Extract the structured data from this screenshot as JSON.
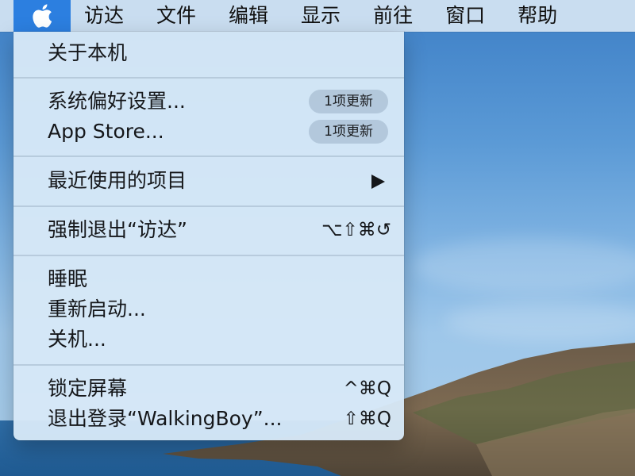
{
  "menubar": {
    "apple_icon": "apple-icon",
    "items": [
      {
        "label": "访达"
      },
      {
        "label": "文件"
      },
      {
        "label": "编辑"
      },
      {
        "label": "显示"
      },
      {
        "label": "前往"
      },
      {
        "label": "窗口"
      },
      {
        "label": "帮助"
      }
    ]
  },
  "apple_menu": {
    "about": "关于本机",
    "system_prefs": {
      "label": "系统偏好设置...",
      "badge": "1项更新"
    },
    "app_store": {
      "label": "App Store...",
      "badge": "1项更新"
    },
    "recent_items": {
      "label": "最近使用的项目",
      "icon": "submenu-arrow-icon"
    },
    "force_quit": {
      "label": "强制退出“访达”",
      "shortcut": "⌥⇧⌘↺"
    },
    "sleep": "睡眠",
    "restart": "重新启动...",
    "shutdown": "关机...",
    "lock_screen": {
      "label": "锁定屏幕",
      "shortcut": "^⌘Q"
    },
    "logout": {
      "label": "退出登录“WalkingBoy”...",
      "shortcut": "⇧⌘Q"
    }
  },
  "colors": {
    "apple_highlight": "#2c7fe0",
    "menu_background": "#d6e8f7",
    "badge_background": "#a0b6cc"
  }
}
